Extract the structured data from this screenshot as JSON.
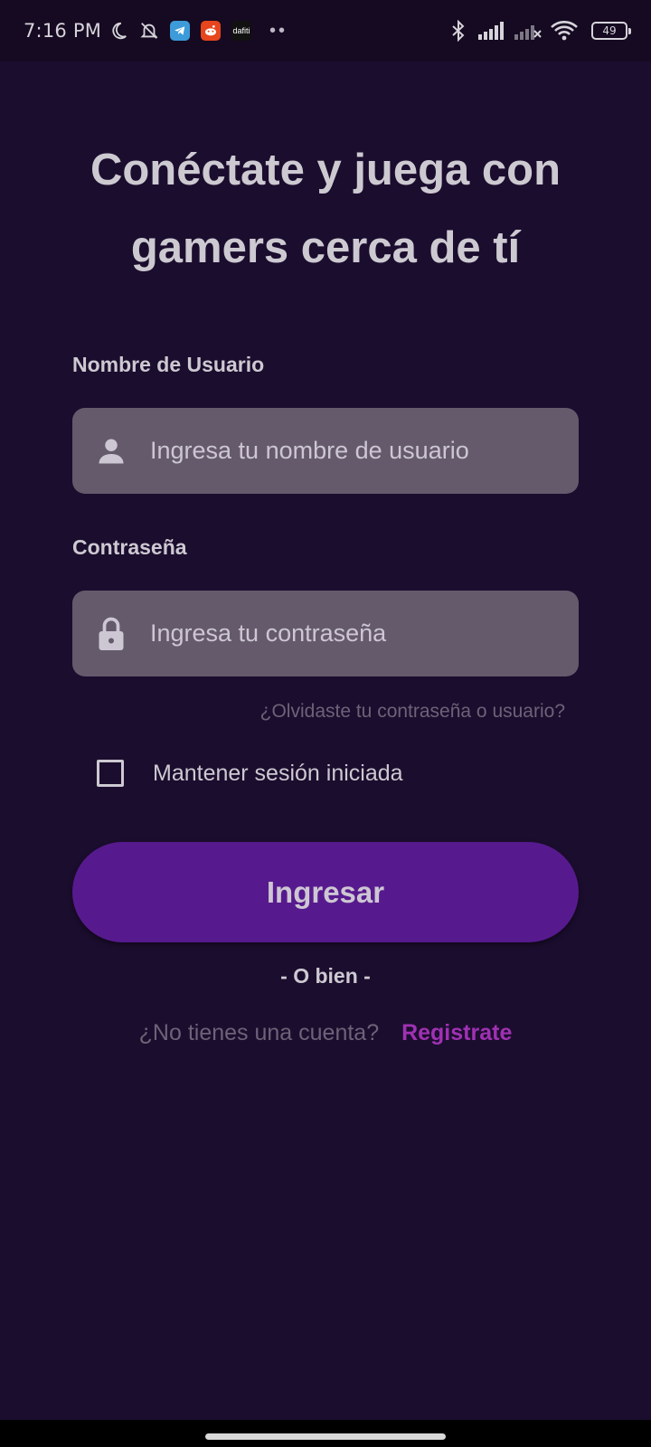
{
  "status_bar": {
    "time": "7:16 PM",
    "battery": "49",
    "app_badges": [
      {
        "name": "telegram",
        "color": "#3d9bd9"
      },
      {
        "name": "reddit",
        "color": "#e7451d"
      },
      {
        "name": "daffa",
        "color": "#111111",
        "text": "dafiti"
      }
    ],
    "overflow": "••"
  },
  "headline": {
    "line1": "Conéctate y juega con",
    "line2": "gamers cerca de tí"
  },
  "username": {
    "label": "Nombre de Usuario",
    "placeholder": "Ingresa tu nombre de usuario",
    "value": "",
    "icon": "person-icon"
  },
  "password": {
    "label": "Contraseña",
    "placeholder": "Ingresa tu contraseña",
    "value": "",
    "icon": "lock-icon"
  },
  "forgot_link": "¿Olvidaste tu contraseña o usuario?",
  "remember_me": {
    "label": "Mantener sesión iniciada",
    "checked": false
  },
  "login_button": "Ingresar",
  "divider_text": "- O bien -",
  "signup": {
    "prompt": "¿No tienes una cuenta?",
    "link": "Registrate"
  },
  "colors": {
    "background": "#1b0d2e",
    "button": "#571a8e",
    "input": "#655a6c",
    "link_accent": "#a031b3"
  }
}
